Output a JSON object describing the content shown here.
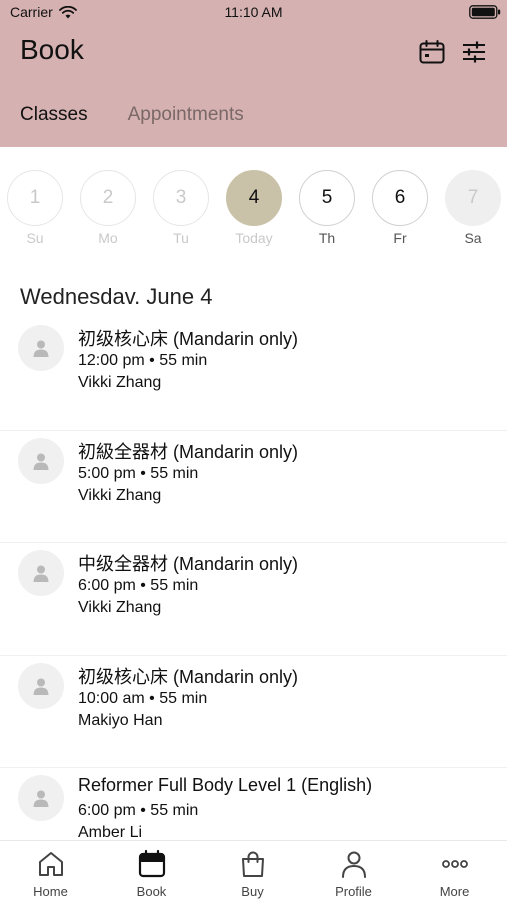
{
  "status_bar": {
    "carrier": "Carrier",
    "time": "11:10 AM"
  },
  "header": {
    "title": "Book",
    "icons": [
      "calendar-icon",
      "filter-sliders-icon"
    ],
    "tabs": [
      {
        "label": "Classes",
        "active": true
      },
      {
        "label": "Appointments",
        "active": false
      }
    ],
    "background": "#d6b1b1"
  },
  "week": [
    {
      "number": "1",
      "label": "Su"
    },
    {
      "number": "2",
      "label": "Mo"
    },
    {
      "number": "3",
      "label": "Tu"
    },
    {
      "number": "4",
      "label": "Today"
    },
    {
      "number": "5",
      "label": "Th"
    },
    {
      "number": "6",
      "label": "Fr"
    },
    {
      "number": "7",
      "label": "Sa"
    }
  ],
  "selected_date": "Wednesdav. June 4",
  "classes": [
    {
      "name": "初级核心床 (Mandarin only)",
      "time": "12:00 pm • 55 min",
      "instructor": "Vikki Zhang"
    },
    {
      "name": "初級全器材 (Mandarin only)",
      "time": "5:00 pm • 55 min",
      "instructor": "Vikki Zhang"
    },
    {
      "name": "中级全器材 (Mandarin only)",
      "time": "6:00 pm • 55 min",
      "instructor": "Vikki Zhang"
    },
    {
      "name": "初级核心床 (Mandarin only)",
      "time": "10:00 am • 55 min",
      "instructor": "Makiyo Han"
    },
    {
      "name": "Reformer Full Body Level 1 (English)",
      "time": "6:00 pm • 55 min",
      "instructor": "Amber Li"
    }
  ],
  "bottom_nav": [
    {
      "label": "Home",
      "icon": "home-icon"
    },
    {
      "label": "Book",
      "icon": "calendar-icon",
      "active": true
    },
    {
      "label": "Buy",
      "icon": "shopping-bag-icon"
    },
    {
      "label": "Profile",
      "icon": "person-icon"
    },
    {
      "label": "More",
      "icon": "more-dots-icon"
    }
  ],
  "colors": {
    "header": "#d6b1b1",
    "today_circle": "#c9c2a8"
  }
}
